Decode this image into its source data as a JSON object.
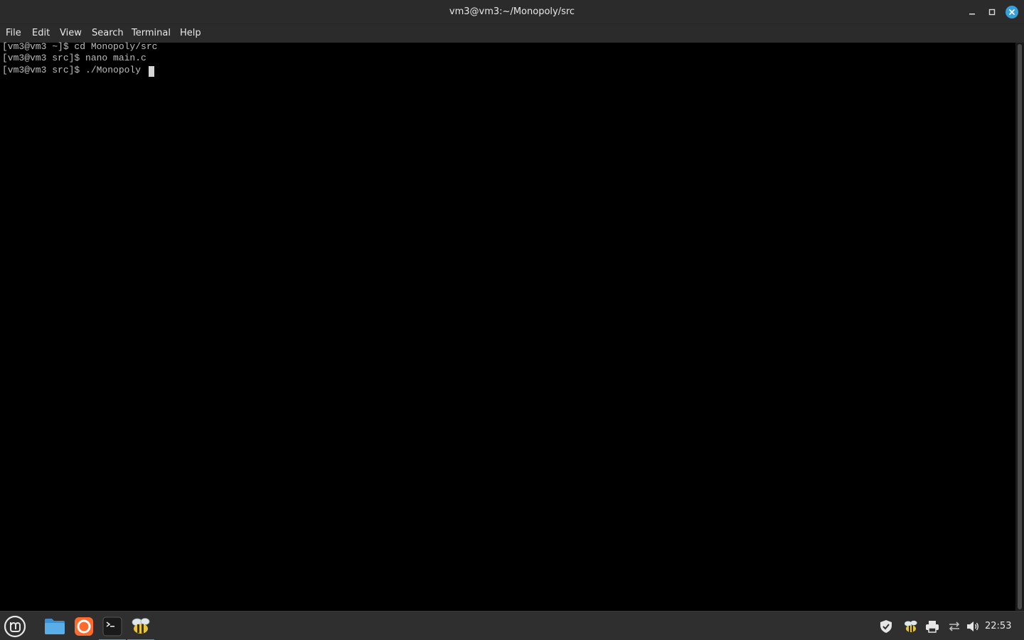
{
  "window": {
    "title": "vm3@vm3:~/Monopoly/src",
    "controls": [
      "minimize-icon",
      "maximize-icon",
      "close-icon"
    ]
  },
  "menubar": {
    "items": [
      {
        "label": "File"
      },
      {
        "label": "Edit"
      },
      {
        "label": "View"
      },
      {
        "label": "Search"
      },
      {
        "label": "Terminal"
      },
      {
        "label": "Help"
      }
    ]
  },
  "terminal": {
    "lines": [
      "[vm3@vm3 ~]$ cd Monopoly/src",
      "[vm3@vm3 src]$ nano main.c",
      "[vm3@vm3 src]$ ./Monopoly "
    ]
  },
  "taskbar": {
    "launchers": [
      {
        "icon": "mint-menu-icon"
      },
      {
        "icon": "files-folder-icon"
      },
      {
        "icon": "firefox-icon"
      },
      {
        "icon": "terminal-icon",
        "active": true
      },
      {
        "icon": "bee-app-icon",
        "active": true
      }
    ],
    "tray": [
      {
        "icon": "shield-icon"
      },
      {
        "icon": "bee-tray-icon"
      },
      {
        "icon": "printer-icon"
      },
      {
        "icon": "network-icon"
      },
      {
        "icon": "volume-icon"
      }
    ],
    "clock": "22:53"
  },
  "colors": {
    "accent": "#35a0da",
    "titlebar": "#2b2b2b",
    "terminal_bg": "#000000",
    "terminal_fg": "#bdbdbd",
    "taskbar": "#2f2f2f"
  }
}
